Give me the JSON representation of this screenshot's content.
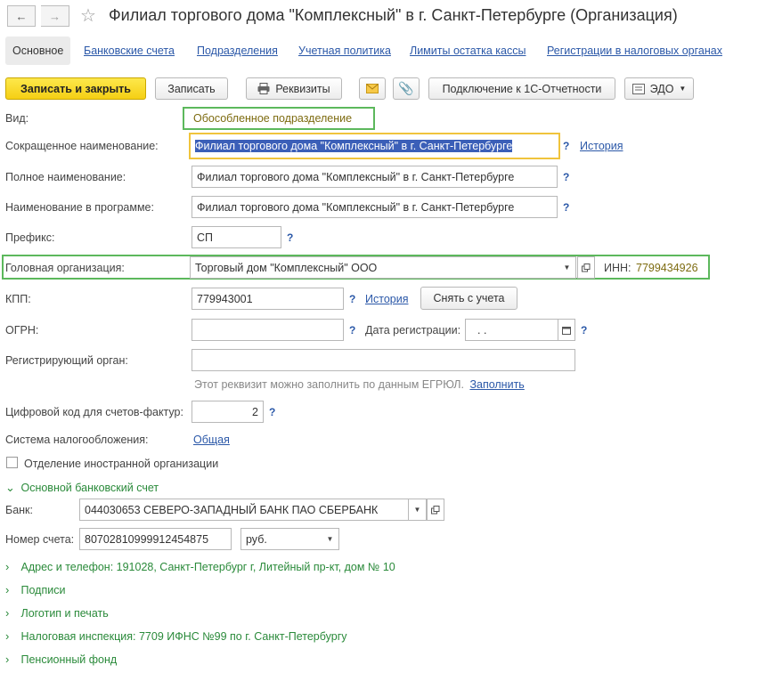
{
  "window": {
    "title": "Филиал торгового дома \"Комплексный\" в г. Санкт-Петербурге (Организация)"
  },
  "tabs": [
    {
      "label": "Основное"
    },
    {
      "label": "Банковские счета"
    },
    {
      "label": "Подразделения"
    },
    {
      "label": "Учетная политика"
    },
    {
      "label": "Лимиты остатка кассы"
    },
    {
      "label": "Регистрации в налоговых органах"
    }
  ],
  "toolbar": {
    "save_close": "Записать и закрыть",
    "save": "Записать",
    "requisites": "Реквизиты",
    "connect": "Подключение к 1С-Отчетности",
    "edo": "ЭДО"
  },
  "form": {
    "kind_label": "Вид:",
    "kind_value": "Обособленное подразделение",
    "short_name_label": "Сокращенное наименование:",
    "short_name_value": "Филиал торгового дома \"Комплексный\" в г. Санкт-Петербурге",
    "history_label": "История",
    "full_name_label": "Полное наименование:",
    "full_name_value": "Филиал торгового дома \"Комплексный\" в г. Санкт-Петербурге",
    "program_name_label": "Наименование в программе:",
    "program_name_value": "Филиал торгового дома \"Комплексный\" в г. Санкт-Петербурге",
    "prefix_label": "Префикс:",
    "prefix_value": "СП",
    "head_org_label": "Головная организация:",
    "head_org_value": "Торговый дом \"Комплексный\" ООО",
    "inn_label": "ИНН:",
    "inn_value": "7799434926",
    "kpp_label": "КПП:",
    "kpp_value": "779943001",
    "kpp_history": "История",
    "deregister": "Снять с учета",
    "ogrn_label": "ОГРН:",
    "ogrn_value": "",
    "reg_date_label": "Дата регистрации:",
    "reg_date_value": " .  .",
    "reg_body_label": "Регистрирующий орган:",
    "reg_body_value": "",
    "egrul_hint": "Этот реквизит можно заполнить по данным ЕГРЮЛ.",
    "fill_link": "Заполнить",
    "invoice_code_label": "Цифровой код для счетов-фактур:",
    "invoice_code_value": "2",
    "tax_system_label": "Система налогообложения:",
    "tax_system_value": "Общая",
    "foreign_branch_label": "Отделение иностранной организации",
    "foreign_branch_checked": false,
    "question": "?"
  },
  "bank_section": {
    "title": "Основной банковский счет",
    "bank_label": "Банк:",
    "bank_value": "044030653 СЕВЕРО-ЗАПАДНЫЙ БАНК ПАО СБЕРБАНК",
    "account_label": "Номер счета:",
    "account_value": "80702810999912454875",
    "currency_value": "руб."
  },
  "collapsed_sections": [
    {
      "label": "Адрес и телефон: 191028, Санкт-Петербург г, Литейный пр-кт, дом № 10"
    },
    {
      "label": "Подписи"
    },
    {
      "label": "Логотип и печать"
    },
    {
      "label": "Налоговая инспекция: 7709 ИФНС №99 по г. Санкт-Петербургу"
    },
    {
      "label": "Пенсионный фонд"
    }
  ],
  "colors": {
    "link": "#2b58a8",
    "section_green": "#2a8a3a",
    "highlight_green": "#5cb85c",
    "focus_yellow": "#f0c43c",
    "primary_yellow": "#f5cf14"
  }
}
